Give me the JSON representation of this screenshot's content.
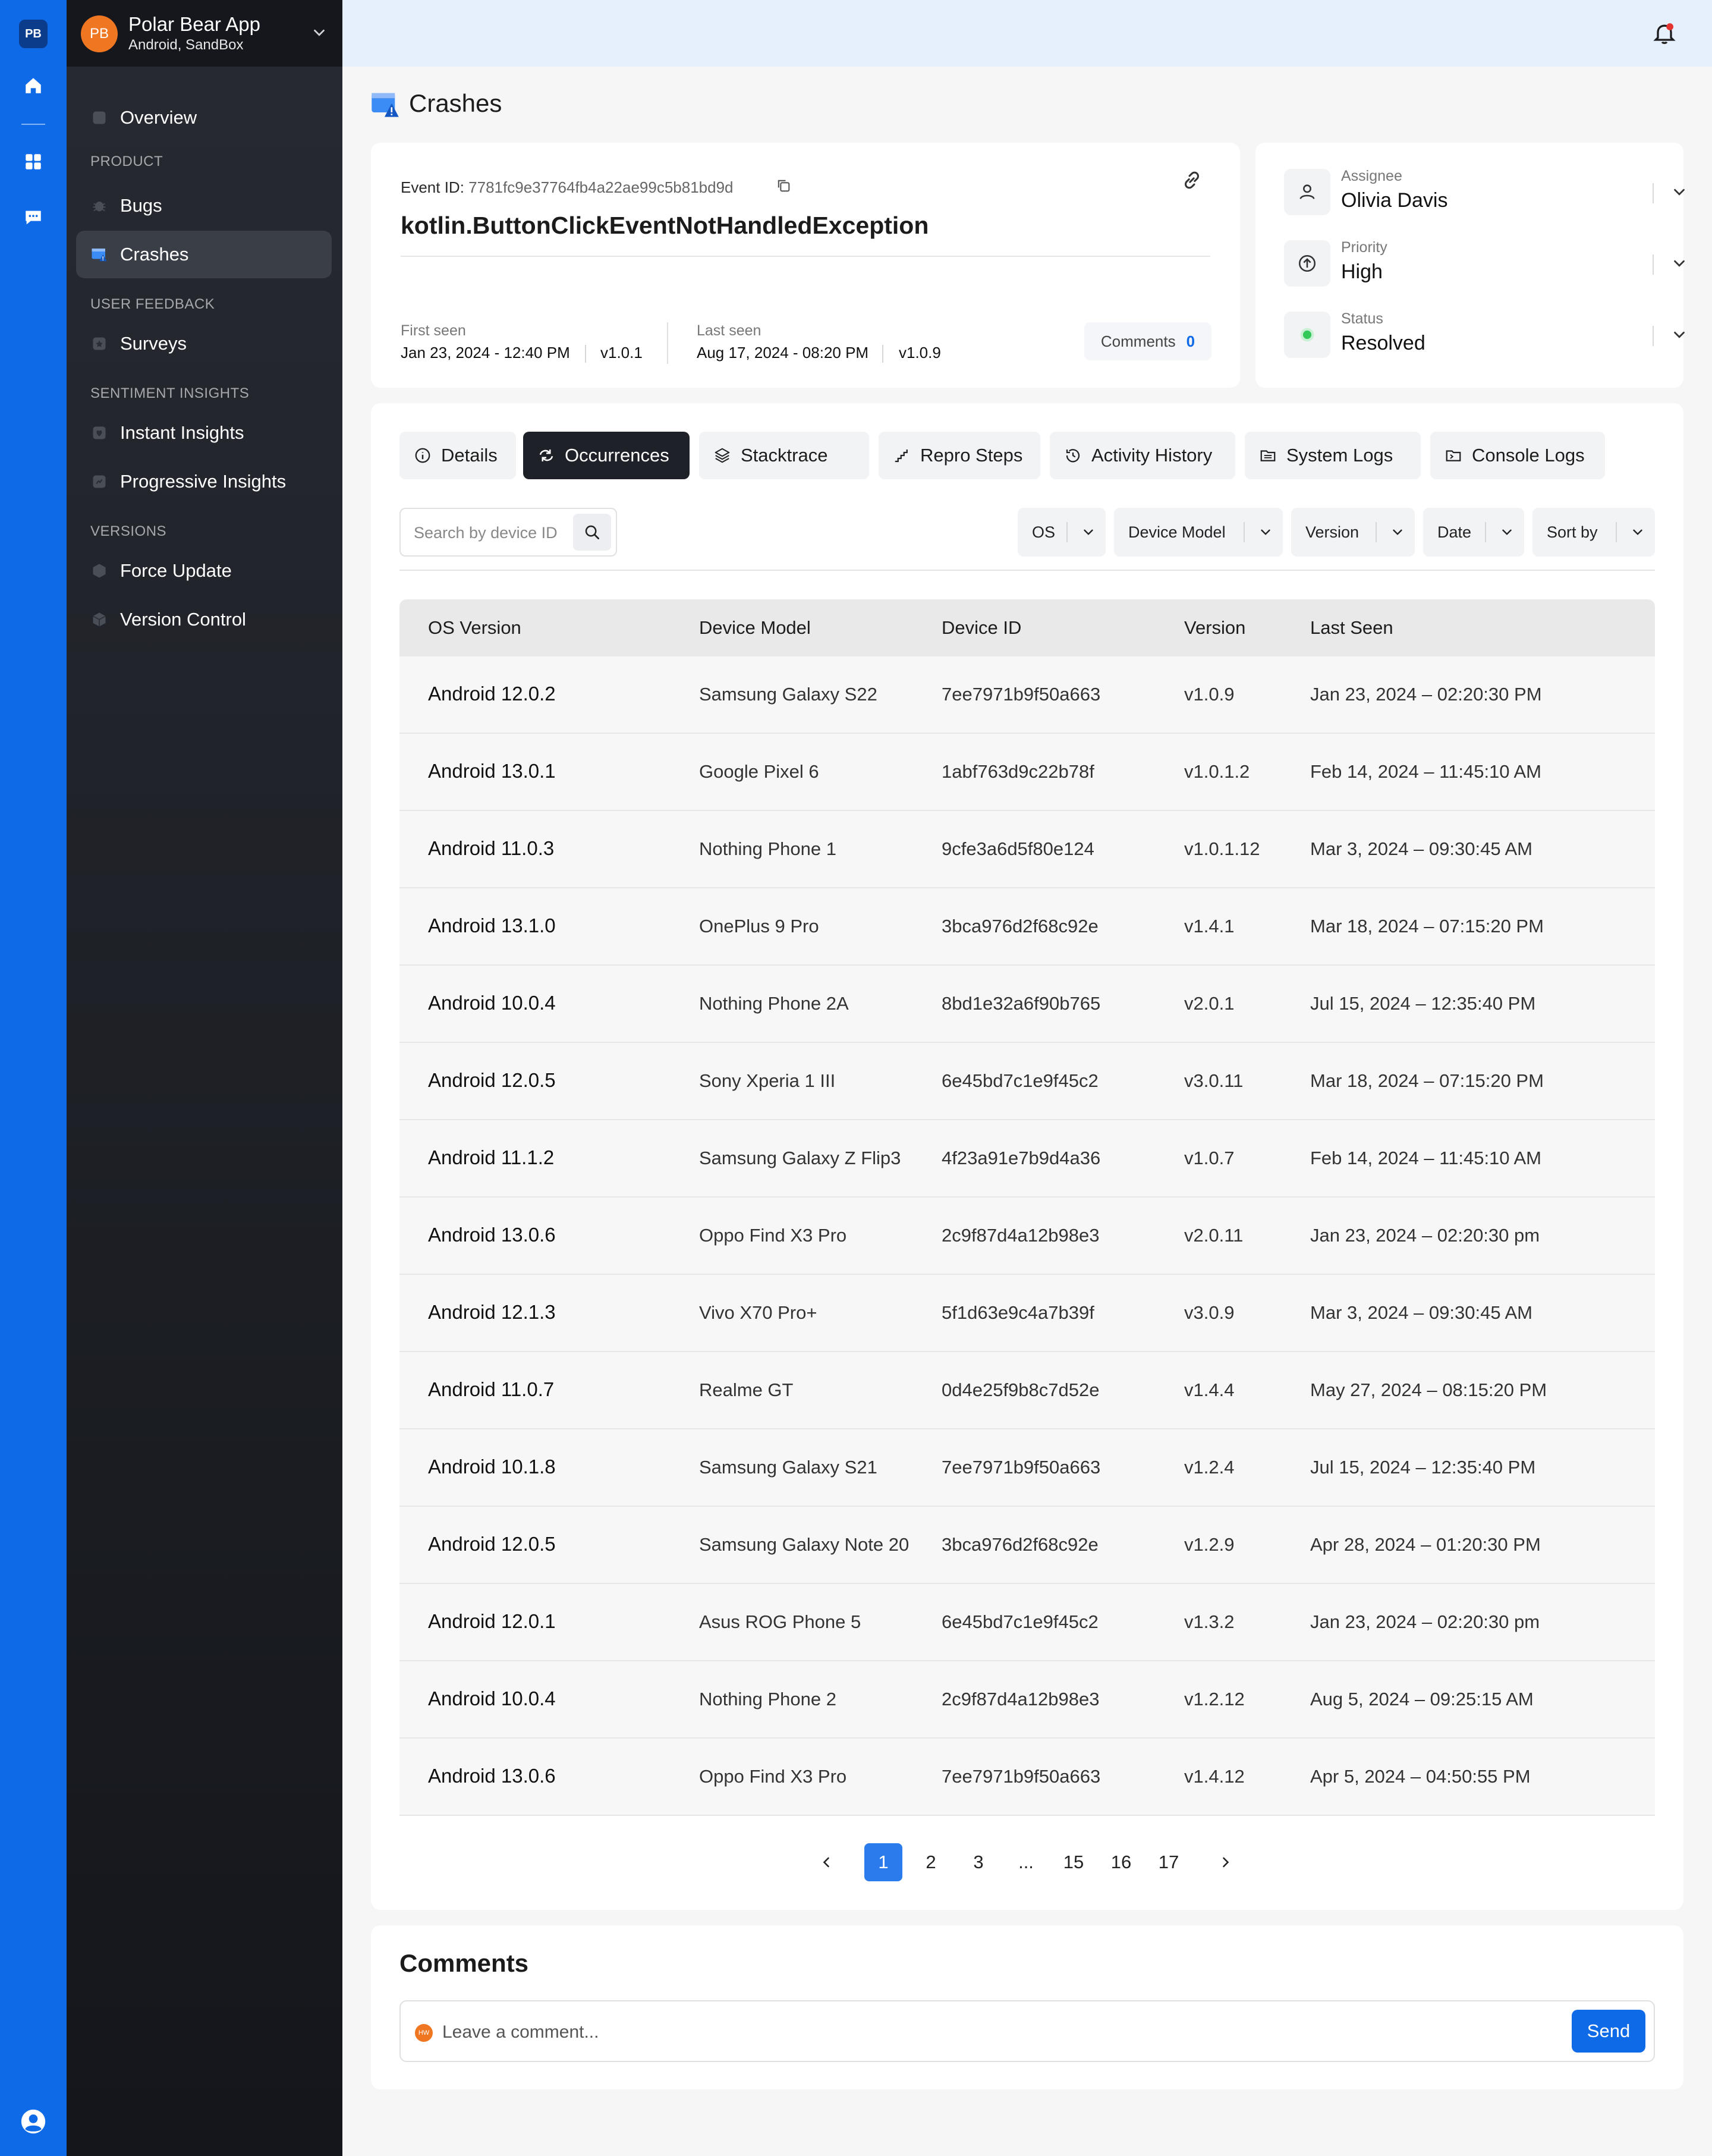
{
  "rail": {
    "logo": "PB",
    "icons": [
      "home-icon",
      "grid-icon",
      "chat-icon",
      "user-avatar-icon"
    ]
  },
  "sidebar": {
    "avatar": "PB",
    "app_name": "Polar Bear App",
    "app_sub": "Android, SandBox",
    "overview": "Overview",
    "sections": {
      "product": "PRODUCT",
      "user_feedback": "USER FEEDBACK",
      "sentiment": "SENTIMENT INSIGHTS",
      "versions": "VERSIONS"
    },
    "items": {
      "bugs": "Bugs",
      "crashes": "Crashes",
      "surveys": "Surveys",
      "instant": "Instant Insights",
      "progressive": "Progressive Insights",
      "force_update": "Force Update",
      "version_control": "Version Control"
    }
  },
  "page": {
    "title": "Crashes"
  },
  "event": {
    "id_label": "Event ID:",
    "id": "7781fc9e37764fb4a22ae99c5b81bd9d",
    "title": "kotlin.ButtonClickEventNotHandledException",
    "first_seen_label": "First seen",
    "first_seen_date": "Jan 23, 2024 - 12:40 PM",
    "first_seen_version": "v1.0.1",
    "last_seen_label": "Last seen",
    "last_seen_date": "Aug 17, 2024 - 08:20 PM",
    "last_seen_version": "v1.0.9",
    "comments_label": "Comments",
    "comments_count": "0"
  },
  "meta": {
    "assignee_label": "Assignee",
    "assignee": "Olivia Davis",
    "priority_label": "Priority",
    "priority": "High",
    "status_label": "Status",
    "status": "Resolved",
    "status_color": "#34c759"
  },
  "tabs": {
    "details": "Details",
    "occurrences": "Occurrences",
    "stacktrace": "Stacktrace",
    "repro": "Repro Steps",
    "activity": "Activity History",
    "system_logs": "System Logs",
    "console_logs": "Console Logs"
  },
  "search": {
    "placeholder": "Search by device ID"
  },
  "filters": {
    "os": "OS",
    "device_model": "Device Model",
    "version": "Version",
    "date": "Date",
    "sort": "Sort by"
  },
  "table": {
    "headers": {
      "os": "OS Version",
      "model": "Device Model",
      "id": "Device ID",
      "version": "Version",
      "last_seen": "Last Seen"
    },
    "rows": [
      {
        "os": "Android 12.0.2",
        "model": "Samsung Galaxy S22",
        "id": "7ee7971b9f50a663",
        "version": "v1.0.9",
        "last_seen": "Jan 23, 2024 – 02:20:30 PM"
      },
      {
        "os": "Android 13.0.1",
        "model": "Google Pixel 6",
        "id": "1abf763d9c22b78f",
        "version": "v1.0.1.2",
        "last_seen": "Feb 14, 2024 – 11:45:10 AM"
      },
      {
        "os": "Android 11.0.3",
        "model": "Nothing Phone 1",
        "id": "9cfe3a6d5f80e124",
        "version": "v1.0.1.12",
        "last_seen": "Mar 3, 2024 – 09:30:45 AM"
      },
      {
        "os": "Android 13.1.0",
        "model": "OnePlus 9 Pro",
        "id": "3bca976d2f68c92e",
        "version": "v1.4.1",
        "last_seen": "Mar 18, 2024 – 07:15:20 PM"
      },
      {
        "os": "Android 10.0.4",
        "model": "Nothing Phone 2A",
        "id": "8bd1e32a6f90b765",
        "version": "v2.0.1",
        "last_seen": "Jul 15, 2024 – 12:35:40 PM"
      },
      {
        "os": "Android 12.0.5",
        "model": "Sony Xperia 1 III",
        "id": "6e45bd7c1e9f45c2",
        "version": "v3.0.11",
        "last_seen": "Mar 18, 2024 – 07:15:20 PM"
      },
      {
        "os": "Android 11.1.2",
        "model": "Samsung Galaxy Z Flip3",
        "id": "4f23a91e7b9d4a36",
        "version": "v1.0.7",
        "last_seen": "Feb 14, 2024 – 11:45:10 AM"
      },
      {
        "os": "Android 13.0.6",
        "model": "Oppo Find X3 Pro",
        "id": "2c9f87d4a12b98e3",
        "version": "v2.0.11",
        "last_seen": "Jan 23, 2024 – 02:20:30 pm"
      },
      {
        "os": "Android 12.1.3",
        "model": "Vivo X70 Pro+",
        "id": "5f1d63e9c4a7b39f",
        "version": "v3.0.9",
        "last_seen": "Mar 3, 2024 – 09:30:45 AM"
      },
      {
        "os": "Android 11.0.7",
        "model": "Realme GT",
        "id": "0d4e25f9b8c7d52e",
        "version": "v1.4.4",
        "last_seen": "May 27, 2024 – 08:15:20 PM"
      },
      {
        "os": "Android 10.1.8",
        "model": "Samsung Galaxy S21",
        "id": "7ee7971b9f50a663",
        "version": "v1.2.4",
        "last_seen": "Jul 15, 2024 – 12:35:40 PM"
      },
      {
        "os": "Android 12.0.5",
        "model": "Samsung Galaxy Note 20",
        "id": "3bca976d2f68c92e",
        "version": "v1.2.9",
        "last_seen": "Apr 28, 2024 – 01:20:30 PM"
      },
      {
        "os": "Android 12.0.1",
        "model": "Asus ROG Phone 5",
        "id": "6e45bd7c1e9f45c2",
        "version": "v1.3.2",
        "last_seen": "Jan 23, 2024 – 02:20:30 pm"
      },
      {
        "os": "Android 10.0.4",
        "model": "Nothing Phone 2",
        "id": "2c9f87d4a12b98e3",
        "version": "v1.2.12",
        "last_seen": "Aug 5, 2024 – 09:25:15 AM"
      },
      {
        "os": "Android 13.0.6",
        "model": "Oppo Find X3 Pro",
        "id": "7ee7971b9f50a663",
        "version": "v1.4.12",
        "last_seen": "Apr 5, 2024 – 04:50:55 PM"
      }
    ]
  },
  "pagination": {
    "pages": [
      "1",
      "2",
      "3",
      "...",
      "15",
      "16",
      "17"
    ],
    "current": "1"
  },
  "comments": {
    "title": "Comments",
    "avatar": "HW",
    "placeholder": "Leave a comment...",
    "send": "Send"
  },
  "colors": {
    "accent": "#0f6ae8",
    "sidebar_active": "#3a3e47",
    "avatar": "#f07722"
  }
}
